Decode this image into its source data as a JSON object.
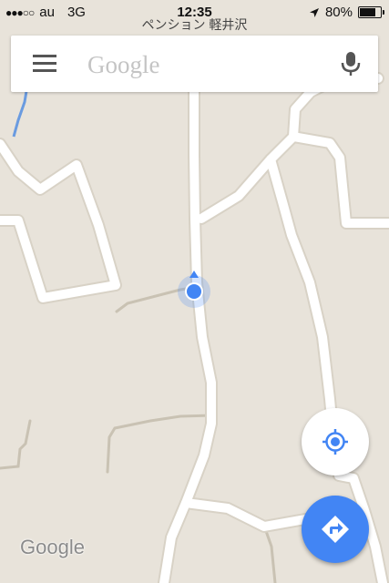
{
  "status_bar": {
    "carrier": "au",
    "network": "3G",
    "time": "12:35",
    "battery": "80%",
    "battery_level": 0.8
  },
  "map": {
    "place_label": "ペンション 軽井沢",
    "watermark": "Google",
    "colors": {
      "land": "#e8e3da",
      "road": "#ffffff",
      "path": "#c9c2b3",
      "water": "#6a9be0",
      "location": "#4285f4"
    }
  },
  "search": {
    "placeholder": "Google",
    "value": "",
    "menu_icon": "hamburger-menu-icon",
    "mic_icon": "microphone-icon"
  },
  "controls": {
    "my_location_icon": "crosshair-location-icon",
    "directions_icon": "directions-arrow-icon"
  }
}
